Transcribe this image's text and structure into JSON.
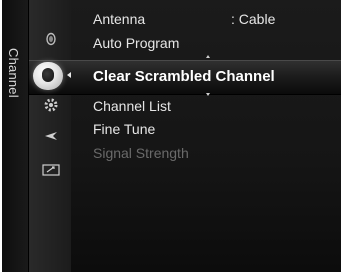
{
  "sidebar": {
    "label": "Channel"
  },
  "menu": {
    "items": [
      {
        "label": "Antenna",
        "value": ": Cable",
        "state": "normal"
      },
      {
        "label": "Auto Program",
        "state": "normal"
      },
      {
        "label": "Clear Scrambled Channel",
        "state": "selected"
      },
      {
        "label": "Channel List",
        "state": "normal"
      },
      {
        "label": "Fine Tune",
        "state": "normal"
      },
      {
        "label": "Signal Strength",
        "state": "disabled"
      }
    ]
  },
  "icons": [
    {
      "name": "picture-icon"
    },
    {
      "name": "channel-icon",
      "selected": true
    },
    {
      "name": "setup-icon"
    },
    {
      "name": "input-icon"
    },
    {
      "name": "application-icon"
    }
  ],
  "colors": {
    "background": "#151515",
    "text": "#e6e6e6",
    "selected_text": "#ffffff",
    "disabled_text": "#6a6a6a"
  }
}
